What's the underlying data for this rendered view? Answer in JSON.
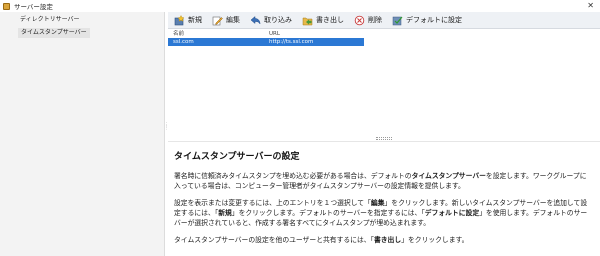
{
  "window": {
    "title": "サーバー設定",
    "close_glyph": "✕"
  },
  "sidebar": {
    "items": [
      {
        "label": "ディレクトリサーバー",
        "selected": false
      },
      {
        "label": "タイムスタンプサーバー",
        "selected": true
      }
    ]
  },
  "toolbar": {
    "new": "新規",
    "edit": "編集",
    "import": "取り込み",
    "export": "書き出し",
    "delete": "削除",
    "set_default": "デフォルトに設定"
  },
  "table": {
    "headers": {
      "name": "名前",
      "url": "URL"
    },
    "rows": [
      {
        "name": "ssl.com",
        "url": "http://ts.ssl.com"
      }
    ]
  },
  "help": {
    "heading": "タイムスタンプサーバーの設定",
    "p1": [
      "署名時に信頼済みタイムスタンプを埋め込む必要がある場合は、デフォルトの",
      "タイムスタンプサーバー",
      "を設定します。ワークグループに入っている場合は、コンピューター管理者がタイムスタンプサーバーの設定情報を提供します。"
    ],
    "p2": [
      "設定を表示または変更するには、上のエントリを１つ選択して「",
      "編集",
      "」をクリックします。新しいタイムスタンプサーバーを追加して設定するには、「",
      "新規",
      "」をクリックします。デフォルトのサーバーを指定するには、「",
      "デフォルトに設定",
      "」を使用します。デフォルトのサーバーが選択されていると、作成する署名すべてにタイムスタンプが埋め込まれます。"
    ],
    "p3": [
      "タイムスタンプサーバーの設定を他のユーザーと共有するには、「",
      "書き出し",
      "」をクリックします。"
    ]
  },
  "colors": {
    "selection": "#2b78d4",
    "toolbar_bg": "#eef1f5",
    "sidebar_bg": "#f3f3f3"
  }
}
